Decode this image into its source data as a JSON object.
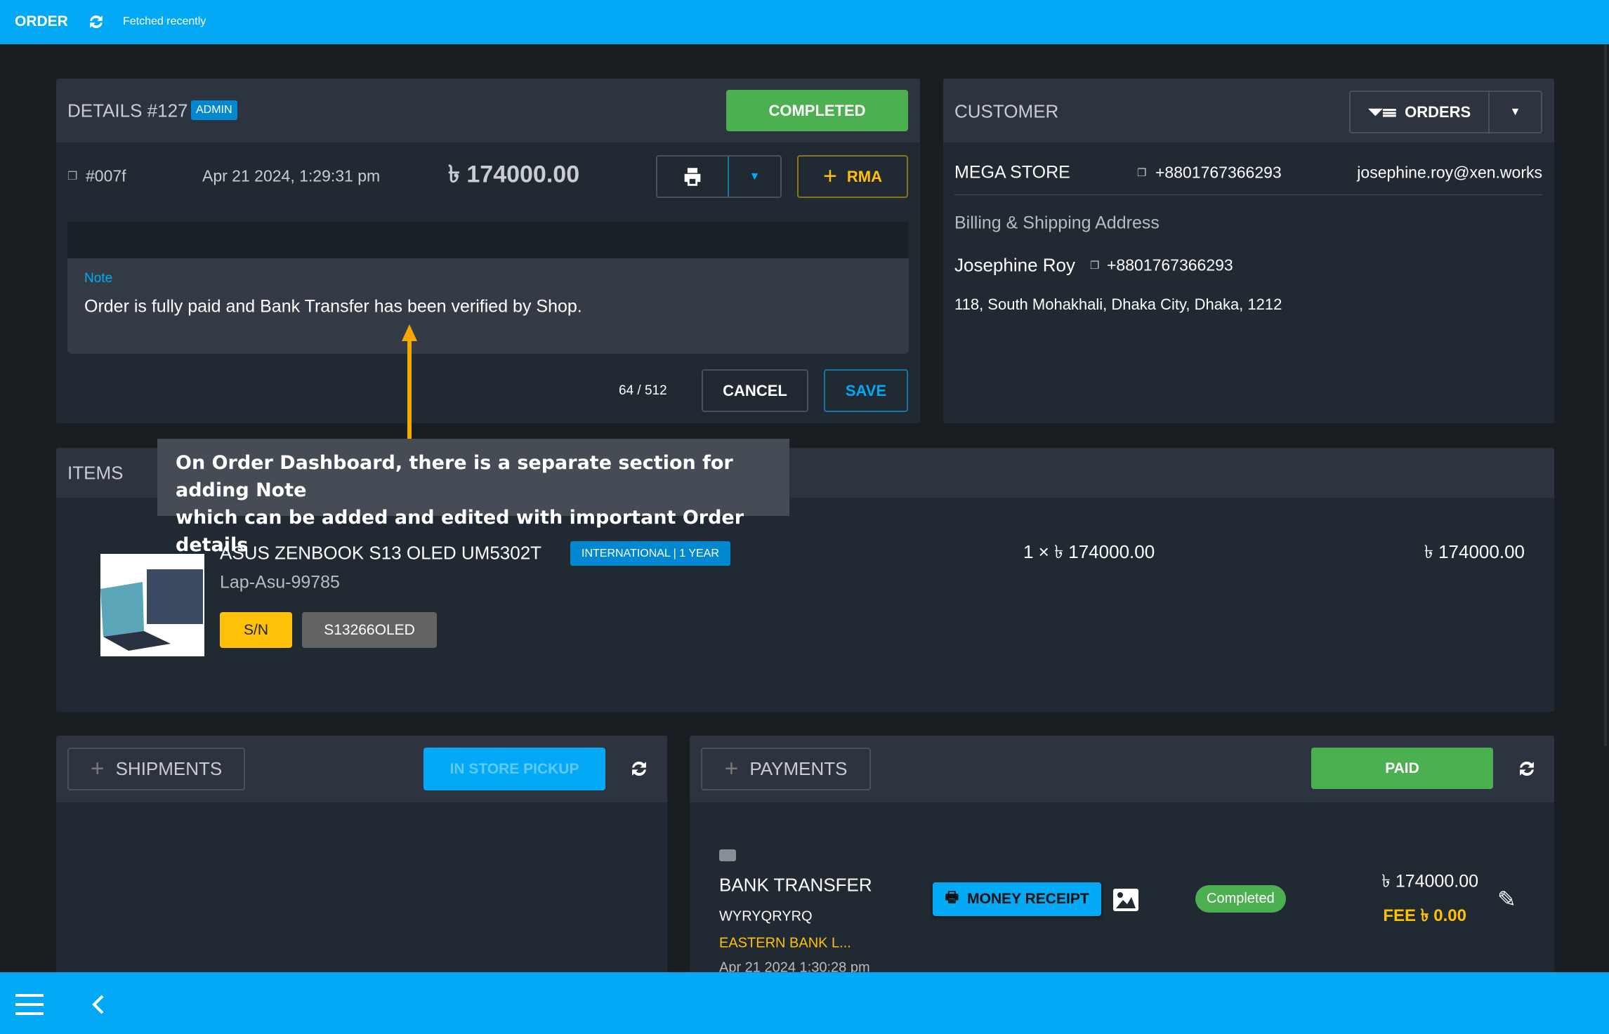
{
  "topbar": {
    "title": "ORDER",
    "status": "Fetched recently"
  },
  "details": {
    "title": "DETAILS #127",
    "role_badge": "ADMIN",
    "status_button": "COMPLETED",
    "order_code": "#007f",
    "date": "Apr 21 2024, 1:29:31 pm",
    "total": "৳ 174000.00",
    "rma_label": "RMA",
    "note_label": "Note",
    "note_text": "Order is fully paid and Bank Transfer has been verified by Shop.",
    "char_count": "64 / 512",
    "cancel_label": "CANCEL",
    "save_label": "SAVE"
  },
  "customer": {
    "title": "CUSTOMER",
    "orders_label": "ORDERS",
    "store": "MEGA STORE",
    "store_phone": "+8801767366293",
    "email": "josephine.roy@xen.works",
    "address_heading": "Billing & Shipping Address",
    "name": "Josephine Roy",
    "phone": "+8801767366293",
    "address": "118, South Mohakhali, Dhaka City, Dhaka, 1212"
  },
  "items": {
    "title": "ITEMS",
    "rows": [
      {
        "name": "ASUS ZENBOOK S13 OLED UM5302T",
        "sku": "Lap-Asu-99785",
        "warranty": "INTERNATIONAL | 1 YEAR",
        "qty_price": "1 × ৳ 174000.00",
        "line_total": "৳ 174000.00",
        "sn_label": "S/N",
        "serial": "S13266OLED"
      }
    ]
  },
  "annotation": {
    "text_line1": "On Order Dashboard, there is a separate section for adding Note",
    "text_line2": "which can be added and edited with important Order details",
    "color": "#f5a800"
  },
  "shipments": {
    "title": "SHIPMENTS",
    "method": "IN STORE PICKUP"
  },
  "payments": {
    "title": "PAYMENTS",
    "status": "PAID",
    "rows": [
      {
        "method": "BANK TRANSFER",
        "reference": "WYRYQRYRQ",
        "bank": "EASTERN BANK L...",
        "date": "Apr 21 2024 1:30:28 pm",
        "receipt_label": "MONEY RECEIPT",
        "status": "Completed",
        "amount": "৳ 174000.00",
        "fee": "FEE ৳ 0.00"
      }
    ]
  },
  "colors": {
    "primary": "#03a9f4",
    "success": "#4caf50",
    "warning": "#ffc107",
    "panel": "#212932"
  }
}
